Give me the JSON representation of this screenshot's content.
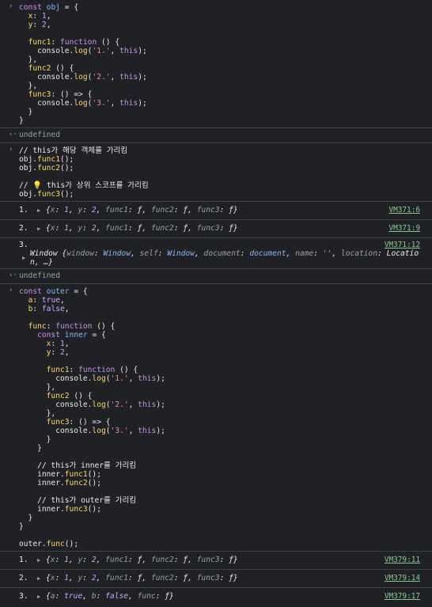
{
  "prompt_symbol": "›",
  "return_symbol": "‹·",
  "undefined_text": "undefined",
  "block1": {
    "lines": [
      "const obj = {",
      "  x: 1,",
      "  y: 2,",
      "",
      "  func1: function () {",
      "    console.log('1.', this);",
      "  },",
      "  func2 () {",
      "    console.log('2.', this);",
      "  },",
      "  func3: () => {",
      "    console.log('3.', this);",
      "  }",
      "}"
    ]
  },
  "block2": {
    "lines": [
      "// this가 해당 객체를 가리킴",
      "obj.func1();",
      "obj.func2();",
      "",
      "// 💡 this가 상위 스코프를 가리킴",
      "obj.func3();"
    ]
  },
  "logs1": [
    {
      "num": "1.",
      "text": "{x: 1, y: 2, func1: ƒ, func2: ƒ, func3: ƒ}",
      "src": "VM371:6"
    },
    {
      "num": "2.",
      "text": "{x: 1, y: 2, func1: ƒ, func2: ƒ, func3: ƒ}",
      "src": "VM371:9"
    }
  ],
  "log_window": {
    "num": "3.",
    "src": "VM371:12",
    "text": "Window {window: Window, self: Window, document: document, name: '', location: Location, …}"
  },
  "block3": {
    "lines": [
      "const outer = {",
      "  a: true,",
      "  b: false,",
      "",
      "  func: function () {",
      "    const inner = {",
      "      x: 1,",
      "      y: 2,",
      "",
      "      func1: function () {",
      "        console.log('1.', this);",
      "      },",
      "      func2 () {",
      "        console.log('2.', this);",
      "      },",
      "      func3: () => {",
      "        console.log('3.', this);",
      "      }",
      "    }",
      "",
      "    // this가 inner를 가리킴",
      "    inner.func1();",
      "    inner.func2();",
      "",
      "    // this가 outer를 가리킴",
      "    inner.func3();",
      "  }",
      "}",
      "",
      "outer.func();"
    ]
  },
  "logs2": [
    {
      "num": "1.",
      "text": "{x: 1, y: 2, func1: ƒ, func2: ƒ, func3: ƒ}",
      "src": "VM379:11"
    },
    {
      "num": "2.",
      "text": "{x: 1, y: 2, func1: ƒ, func2: ƒ, func3: ƒ}",
      "src": "VM379:14"
    },
    {
      "num": "3.",
      "text": "{a: true, b: false, func: ƒ}",
      "src": "VM379:17"
    }
  ]
}
